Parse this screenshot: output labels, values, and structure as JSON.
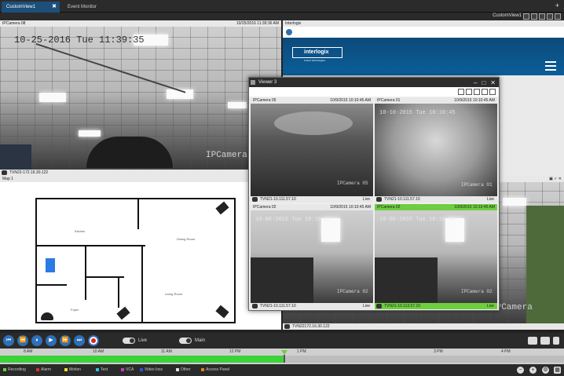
{
  "tabs": [
    {
      "label": "CustomView1",
      "close": "✖"
    },
    {
      "label": "Event Monitor"
    }
  ],
  "tab_add": "+",
  "subbar": {
    "view_name": "CustomView1"
  },
  "panels": {
    "cam08": {
      "name": "IPCamera 08",
      "timestamp": "10/25/2016 11:39:36 AM",
      "osd": "10-25-2016 Tue 11:39:35",
      "cam_label": "IPCamera 08",
      "footer": "TVN22-172.16.30.122"
    },
    "interlogix": {
      "name": "Interlogix",
      "logo": "interlogix",
      "logo_sub": "United Technologies"
    },
    "map": {
      "name": "Map 1",
      "rooms": [
        "Kitchen",
        "Dining Room",
        "Living Room",
        "Foyer"
      ]
    },
    "bottom_right": {
      "footer": "TVN22172.16.30.122",
      "cam_label": "IPCamera"
    }
  },
  "viewer": {
    "title": "Viewer 3",
    "cells": [
      {
        "name": "IPCamera 05",
        "timestamp": "10/9/2015 10:10:45 AM",
        "cam_label": "IPCamera 05",
        "footer": "TVN21-10.111.57.10",
        "live": "Live"
      },
      {
        "name": "IPCamera 01",
        "timestamp": "10/9/2015 10:10:45 AM",
        "osd": "10-10-2015 Tue 10:10:45",
        "cam_label": "IPCamera 01",
        "footer": "TVN21-10.111.57.10",
        "live": "Live"
      },
      {
        "name": "IPCamera 02",
        "timestamp": "10/9/2015 10:10:45 AM",
        "osd": "10-06-2015 Tue 10:10:44",
        "cam_label": "IPCamera 02",
        "footer": "TVN21-10.111.57.10",
        "live": "Live"
      },
      {
        "name": "IPCamera 02",
        "timestamp": "10/9/2015 10:10:45 AM",
        "osd": "10-06-2015 Tue 10:10:44",
        "cam_label": "IPCamera 02",
        "footer": "TVN21-10.113.57.10",
        "live": "Live"
      }
    ]
  },
  "playback": {
    "live_label": "Live",
    "main_label": "Main"
  },
  "timeline": {
    "labels": [
      "8 AM",
      "10 AM",
      "11 AM",
      "12 PM",
      "1 PM",
      "3 PM",
      "4 PM"
    ]
  },
  "legend": [
    {
      "label": "Recording",
      "color": "#6fce3f"
    },
    {
      "label": "Alarm",
      "color": "#e03030"
    },
    {
      "label": "Motion",
      "color": "#f0e030"
    },
    {
      "label": "Text",
      "color": "#30c0e0"
    },
    {
      "label": "VCA",
      "color": "#c040c0"
    },
    {
      "label": "Video loss",
      "color": "#3050e0"
    },
    {
      "label": "Other",
      "color": "#e0e0e0"
    },
    {
      "label": "Access Panel",
      "color": "#e08020"
    }
  ]
}
